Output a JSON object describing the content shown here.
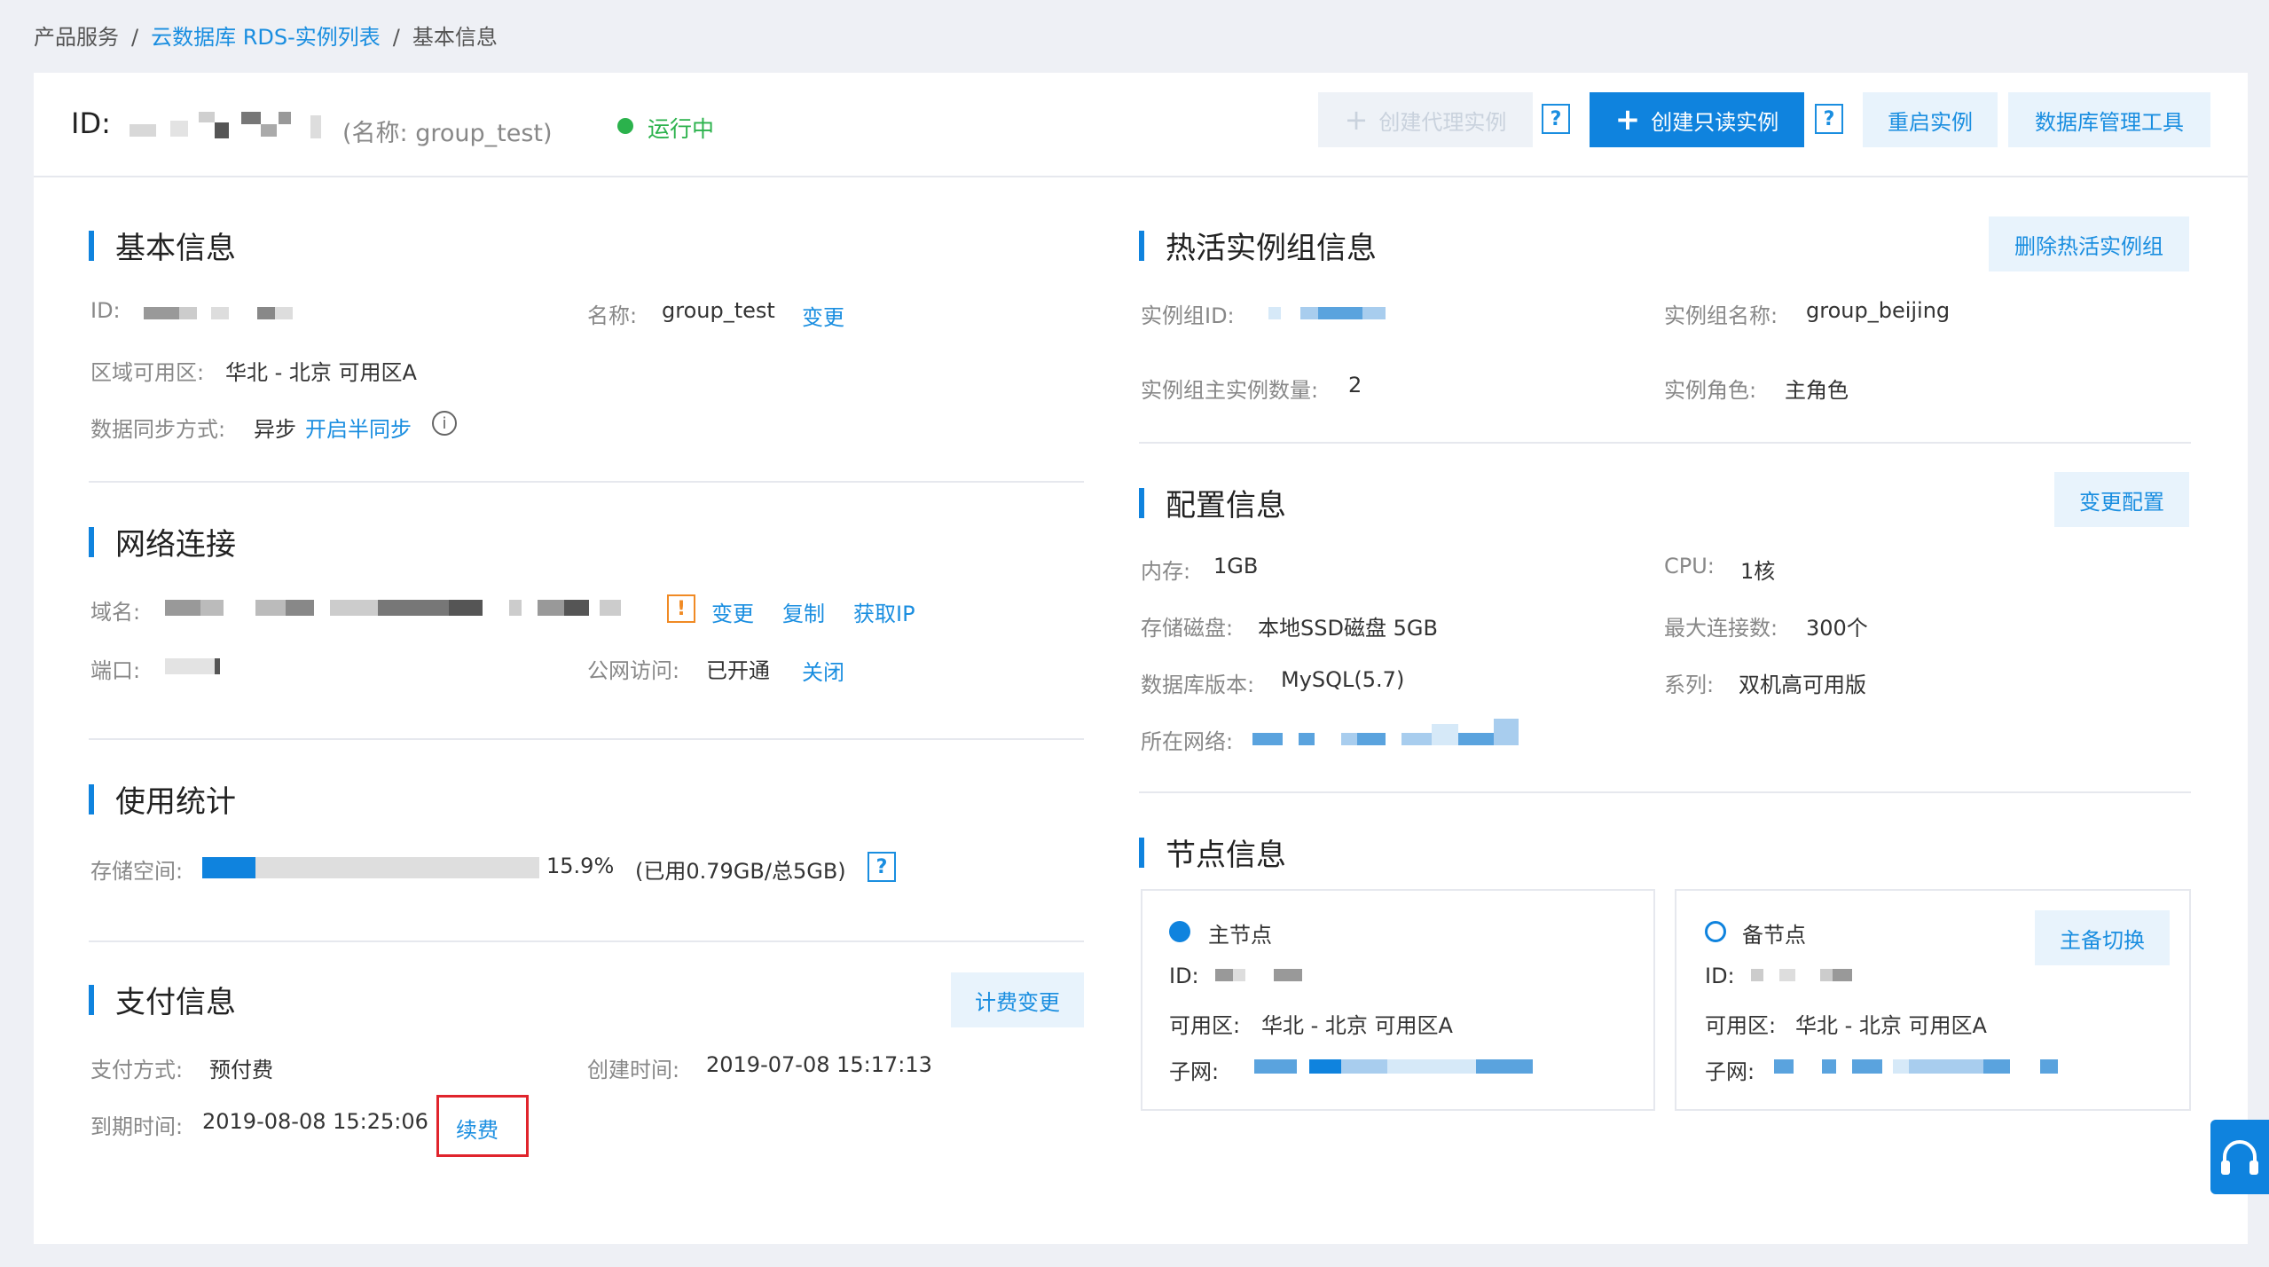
{
  "breadcrumb": {
    "item1": "产品服务",
    "sep": "/",
    "item2": "云数据库 RDS-实例列表",
    "item3": "基本信息"
  },
  "header": {
    "id_label": "ID:",
    "name_text": "(名称: group_test)",
    "status": "运行中",
    "status_color": "#2bb24c",
    "btn_create_proxy": "创建代理实例",
    "btn_create_readonly": "创建只读实例",
    "btn_restart": "重启实例",
    "btn_db_tool": "数据库管理工具",
    "help": "?"
  },
  "basic": {
    "title": "基本信息",
    "id_label": "ID:",
    "name_label": "名称:",
    "name_value": "group_test",
    "name_change": "变更",
    "zone_label": "区域可用区:",
    "zone_value": "华北 - 北京 可用区A",
    "sync_label": "数据同步方式:",
    "sync_value": "异步",
    "sync_link": "开启半同步",
    "info_icon": "i"
  },
  "network": {
    "title": "网络连接",
    "domain_label": "域名:",
    "warn_icon": "!",
    "change": "变更",
    "copy": "复制",
    "get_ip": "获取IP",
    "port_label": "端口:",
    "public_label": "公网访问:",
    "public_value": "已开通",
    "close": "关闭"
  },
  "usage": {
    "title": "使用统计",
    "storage_label": "存储空间:",
    "percent": "15.9%",
    "percent_value": 0.159,
    "detail": "(已用0.79GB/总5GB)",
    "help": "?"
  },
  "payment": {
    "title": "支付信息",
    "billing_change": "计费变更",
    "method_label": "支付方式:",
    "method_value": "预付费",
    "created_label": "创建时间:",
    "created_value": "2019-07-08 15:17:13",
    "expire_label": "到期时间:",
    "expire_value": "2019-08-08 15:25:06",
    "renew": "续费"
  },
  "hot": {
    "title": "热活实例组信息",
    "delete_btn": "删除热活实例组",
    "group_id_label": "实例组ID:",
    "group_name_label": "实例组名称:",
    "group_name_value": "group_beijing",
    "master_count_label": "实例组主实例数量:",
    "master_count_value": "2",
    "role_label": "实例角色:",
    "role_value": "主角色"
  },
  "config": {
    "title": "配置信息",
    "change_btn": "变更配置",
    "mem_label": "内存:",
    "mem_value": "1GB",
    "cpu_label": "CPU:",
    "cpu_value": "1核",
    "disk_label": "存储磁盘:",
    "disk_value": "本地SSD磁盘 5GB",
    "maxconn_label": "最大连接数:",
    "maxconn_value": "300个",
    "version_label": "数据库版本:",
    "version_value": "MySQL(5.7)",
    "series_label": "系列:",
    "series_value": "双机高可用版",
    "network_label": "所在网络:"
  },
  "nodes": {
    "title": "节点信息",
    "master": {
      "name": "主节点",
      "id_label": "ID:",
      "zone_label": "可用区:",
      "zone_value": "华北 - 北京 可用区A",
      "subnet_label": "子网:"
    },
    "slave": {
      "name": "备节点",
      "switch_btn": "主备切换",
      "id_label": "ID:",
      "zone_label": "可用区:",
      "zone_value": "华北 - 北京 可用区A",
      "subnet_label": "子网:"
    }
  },
  "float": {
    "icon": "headset-icon"
  }
}
